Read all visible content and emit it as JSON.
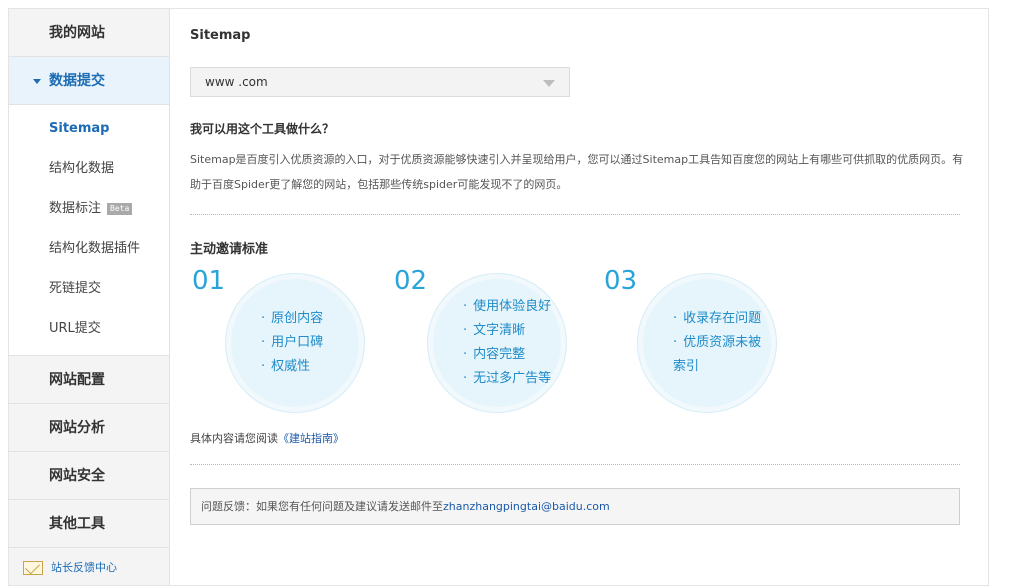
{
  "sidebar": {
    "my_sites": "我的网站",
    "data_submit": "数据提交",
    "sub_items": [
      "Sitemap",
      "结构化数据",
      "数据标注",
      "结构化数据插件",
      "死链提交",
      "URL提交"
    ],
    "beta": "Beta",
    "site_config": "网站配置",
    "site_analysis": "网站分析",
    "site_security": "网站安全",
    "other_tools": "其他工具",
    "feedback_center": "站长反馈中心"
  },
  "main": {
    "title": "Sitemap",
    "site_select_value": "www        .com",
    "question": "我可以用这个工具做什么？",
    "description": "Sitemap是百度引入优质资源的入口，对于优质资源能够快速引入并呈现给用户，您可以通过Sitemap工具告知百度您的网站上有哪些可供抓取的优质网页。有助于百度Spider更了解您的网站，包括那些传统spider可能发现不了的网页。",
    "section_title": "主动邀请标准",
    "steps": [
      {
        "num": "01",
        "points": [
          "原创内容",
          "用户口碑",
          "权威性"
        ]
      },
      {
        "num": "02",
        "points": [
          "使用体验良好",
          "文字清晰",
          "内容完整",
          "无过多广告等"
        ]
      },
      {
        "num": "03",
        "points": [
          "收录存在问题",
          "优质资源未被索引"
        ]
      }
    ],
    "guide_prefix": "具体内容请您阅读",
    "guide_link": "《建站指南》",
    "feedback_prefix": "问题反馈：如果您有任何问题及建议请发送邮件至",
    "feedback_email": "zhanzhangpingtai@baidu.com"
  },
  "colors": {
    "accent": "#1b6bb5",
    "step_number": "#29a4db",
    "circle_bg": "#e6f5fc"
  },
  "icons": {
    "expand": "caret-down-icon",
    "dropdown": "dropdown-arrow-icon",
    "feedback": "envelope-icon"
  }
}
